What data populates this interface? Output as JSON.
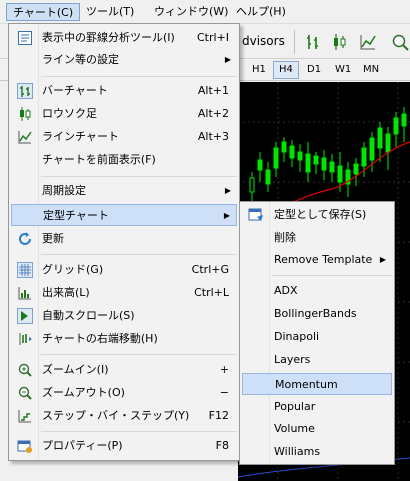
{
  "menubar": {
    "items": [
      {
        "label": "チャート(C)"
      },
      {
        "label": "ツール(T)"
      },
      {
        "label": "ウィンドウ(W)"
      },
      {
        "label": "ヘルプ(H)"
      }
    ]
  },
  "toolbar": {
    "advisors_label": "dvisors"
  },
  "timeframes": [
    "H1",
    "H4",
    "D1",
    "W1",
    "MN"
  ],
  "chart_menu": {
    "items": [
      {
        "label": "表示中の罫線分析ツール(I)",
        "shortcut": "Ctrl+I",
        "icon": "objects-list-icon"
      },
      {
        "label": "ライン等の設定",
        "submenu": true
      },
      {
        "label": "バーチャート",
        "shortcut": "Alt+1",
        "icon": "bar-chart-icon"
      },
      {
        "label": "ロウソク足",
        "shortcut": "Alt+2",
        "icon": "candlestick-icon"
      },
      {
        "label": "ラインチャート",
        "shortcut": "Alt+3",
        "icon": "line-chart-icon"
      },
      {
        "label": "チャートを前面表示(F)"
      },
      {
        "label": "周期設定",
        "submenu": true
      },
      {
        "label": "定型チャート",
        "submenu": true
      },
      {
        "label": "更新",
        "icon": "refresh-icon"
      },
      {
        "label": "グリッド(G)",
        "shortcut": "Ctrl+G",
        "icon": "grid-icon"
      },
      {
        "label": "出来高(L)",
        "shortcut": "Ctrl+L",
        "icon": "volume-icon"
      },
      {
        "label": "自動スクロール(S)",
        "icon": "auto-scroll-icon"
      },
      {
        "label": "チャートの右端移動(H)",
        "icon": "chart-shift-icon"
      },
      {
        "label": "ズームイン(I)",
        "shortcut": "+",
        "icon": "zoom-in-icon"
      },
      {
        "label": "ズームアウト(O)",
        "shortcut": "−",
        "icon": "zoom-out-icon"
      },
      {
        "label": "ステップ・バイ・ステップ(Y)",
        "shortcut": "F12",
        "icon": "step-icon"
      },
      {
        "label": "プロパティー(P)",
        "shortcut": "F8",
        "icon": "properties-icon"
      }
    ]
  },
  "template_menu": {
    "items": [
      {
        "label": "定型として保存(S)",
        "icon": "save-template-icon"
      },
      {
        "label": "削除"
      },
      {
        "label": "Remove Template",
        "submenu": true
      },
      {
        "label": "ADX"
      },
      {
        "label": "BollingerBands"
      },
      {
        "label": "Dinapoli"
      },
      {
        "label": "Layers"
      },
      {
        "label": "Momentum"
      },
      {
        "label": "Popular"
      },
      {
        "label": "Volume"
      },
      {
        "label": "Williams"
      }
    ]
  },
  "submenu_arrow": "▶"
}
